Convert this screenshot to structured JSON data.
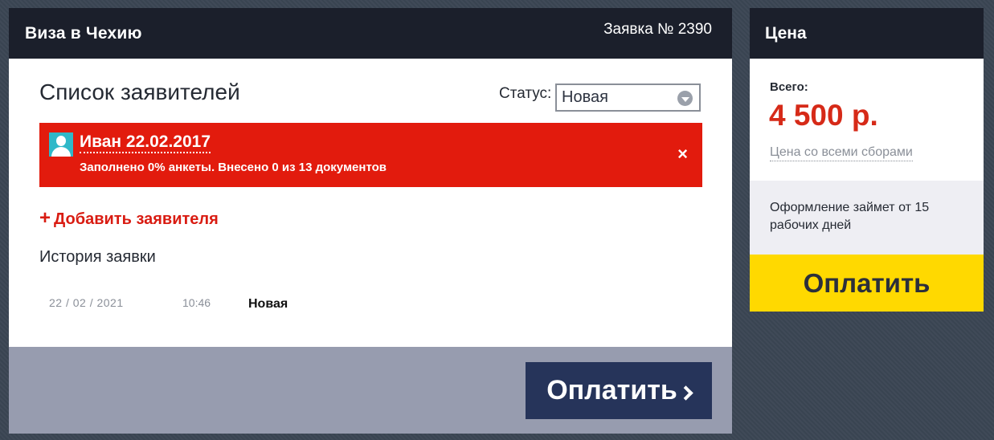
{
  "main": {
    "title": "Виза в Чехию",
    "order_number": "Заявка № 2390",
    "applicants_title": "Список заявителей",
    "status_label": "Статус:",
    "status_value": "Новая",
    "applicant": {
      "name": "Иван 22.02.2017",
      "progress": "Заполнено 0% анкеты. Внесено 0 из 13 документов",
      "close_symbol": "×"
    },
    "add_applicant_plus": "+",
    "add_applicant_label": "Добавить заявителя",
    "history_title": "История заявки",
    "history": [
      {
        "date": "22 / 02 / 2021",
        "time": "10:46",
        "status": "Новая"
      }
    ],
    "pay_button_label": "Оплатить"
  },
  "price": {
    "title": "Цена",
    "total_label": "Всего:",
    "amount": "4 500 р.",
    "fees_link": "Цена со всеми сборами",
    "processing_note": "Оформление займет от 15 рабочих дней",
    "pay_button_label": "Оплатить"
  },
  "icons": {
    "avatar": "user-avatar-icon",
    "select_arrow": "chevron-down-icon",
    "close": "close-icon",
    "pay_chevron": "chevron-right-icon"
  },
  "colors": {
    "header_bg": "#1b1f2b",
    "alert_red": "#e21b0d",
    "accent_red": "#d91c12",
    "pay_navy": "#26345a",
    "pay_yellow": "#ffd900",
    "footer_gray": "#979caf",
    "avatar_teal": "#2fb8c8"
  }
}
